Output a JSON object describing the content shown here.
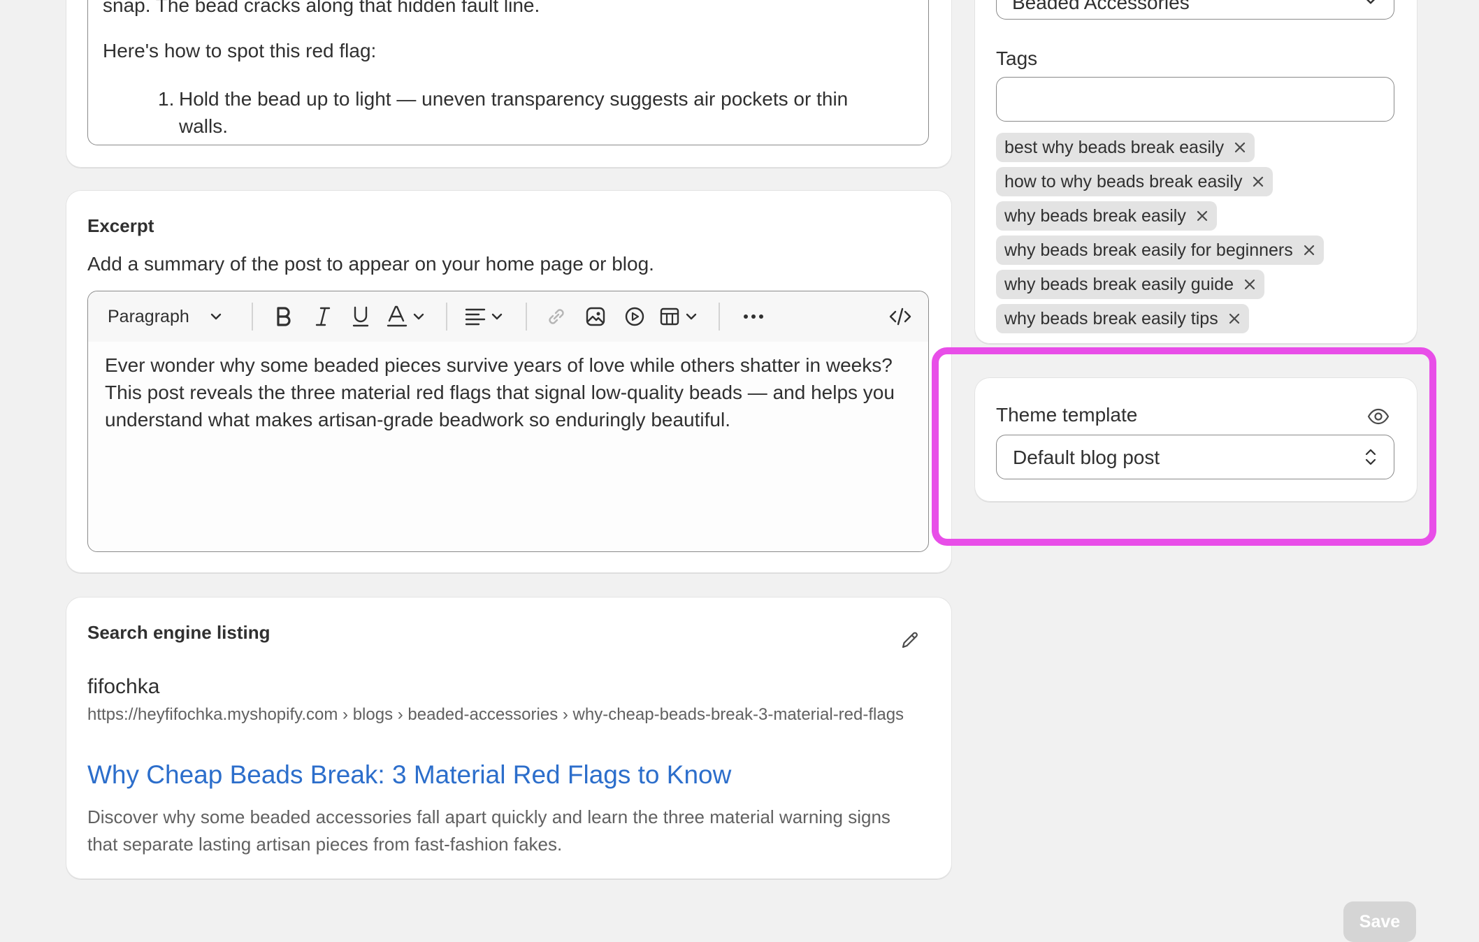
{
  "content_editor": {
    "text_line_1": "snap. The bead cracks along that hidden fault line.",
    "text_line_2": "Here's how to spot this red flag:",
    "list_item_1_num": "1.",
    "list_item_1": "Hold the bead up to light — uneven transparency suggests air pockets or thin walls."
  },
  "excerpt": {
    "title": "Excerpt",
    "help": "Add a summary of the post to appear on your home page or blog.",
    "toolbar": {
      "paragraph_label": "Paragraph",
      "icons": [
        "bold-icon",
        "italic-icon",
        "underline-icon",
        "text-color-icon",
        "align-icon",
        "link-icon",
        "image-icon",
        "video-icon",
        "table-icon",
        "more-icon",
        "code-icon"
      ]
    },
    "text": "Ever wonder why some beaded pieces survive years of love while others shatter in weeks? This post reveals the three material red flags that signal low-quality beads — and helps you understand what makes artisan-grade beadwork so enduringly beautiful."
  },
  "seo": {
    "title": "Search engine listing",
    "store": "fifochka",
    "url": "https://heyfifochka.myshopify.com › blogs › beaded-accessories › why-cheap-beads-break-3-material-red-flags",
    "link_title": "Why Cheap Beads Break: 3 Material Red Flags to Know",
    "description": "Discover why some beaded accessories fall apart quickly and learn the three material warning signs that separate lasting artisan pieces from fast-fashion fakes."
  },
  "organization": {
    "blog_value": "Beaded Accessories",
    "tags_label": "Tags",
    "tags_placeholder": "",
    "tags": [
      "best why beads break easily",
      "how to why beads break easily",
      "why beads break easily",
      "why beads break easily for beginners",
      "why beads break easily guide",
      "why beads break easily tips"
    ]
  },
  "theme_template": {
    "label": "Theme template",
    "value": "Default blog post"
  },
  "footer": {
    "save_label": "Save"
  },
  "colors": {
    "highlight": "#e84ee8",
    "link": "#2c6ecb",
    "tag_bg": "#e3e3e3",
    "save_disabled_bg": "#d5d5d5"
  }
}
